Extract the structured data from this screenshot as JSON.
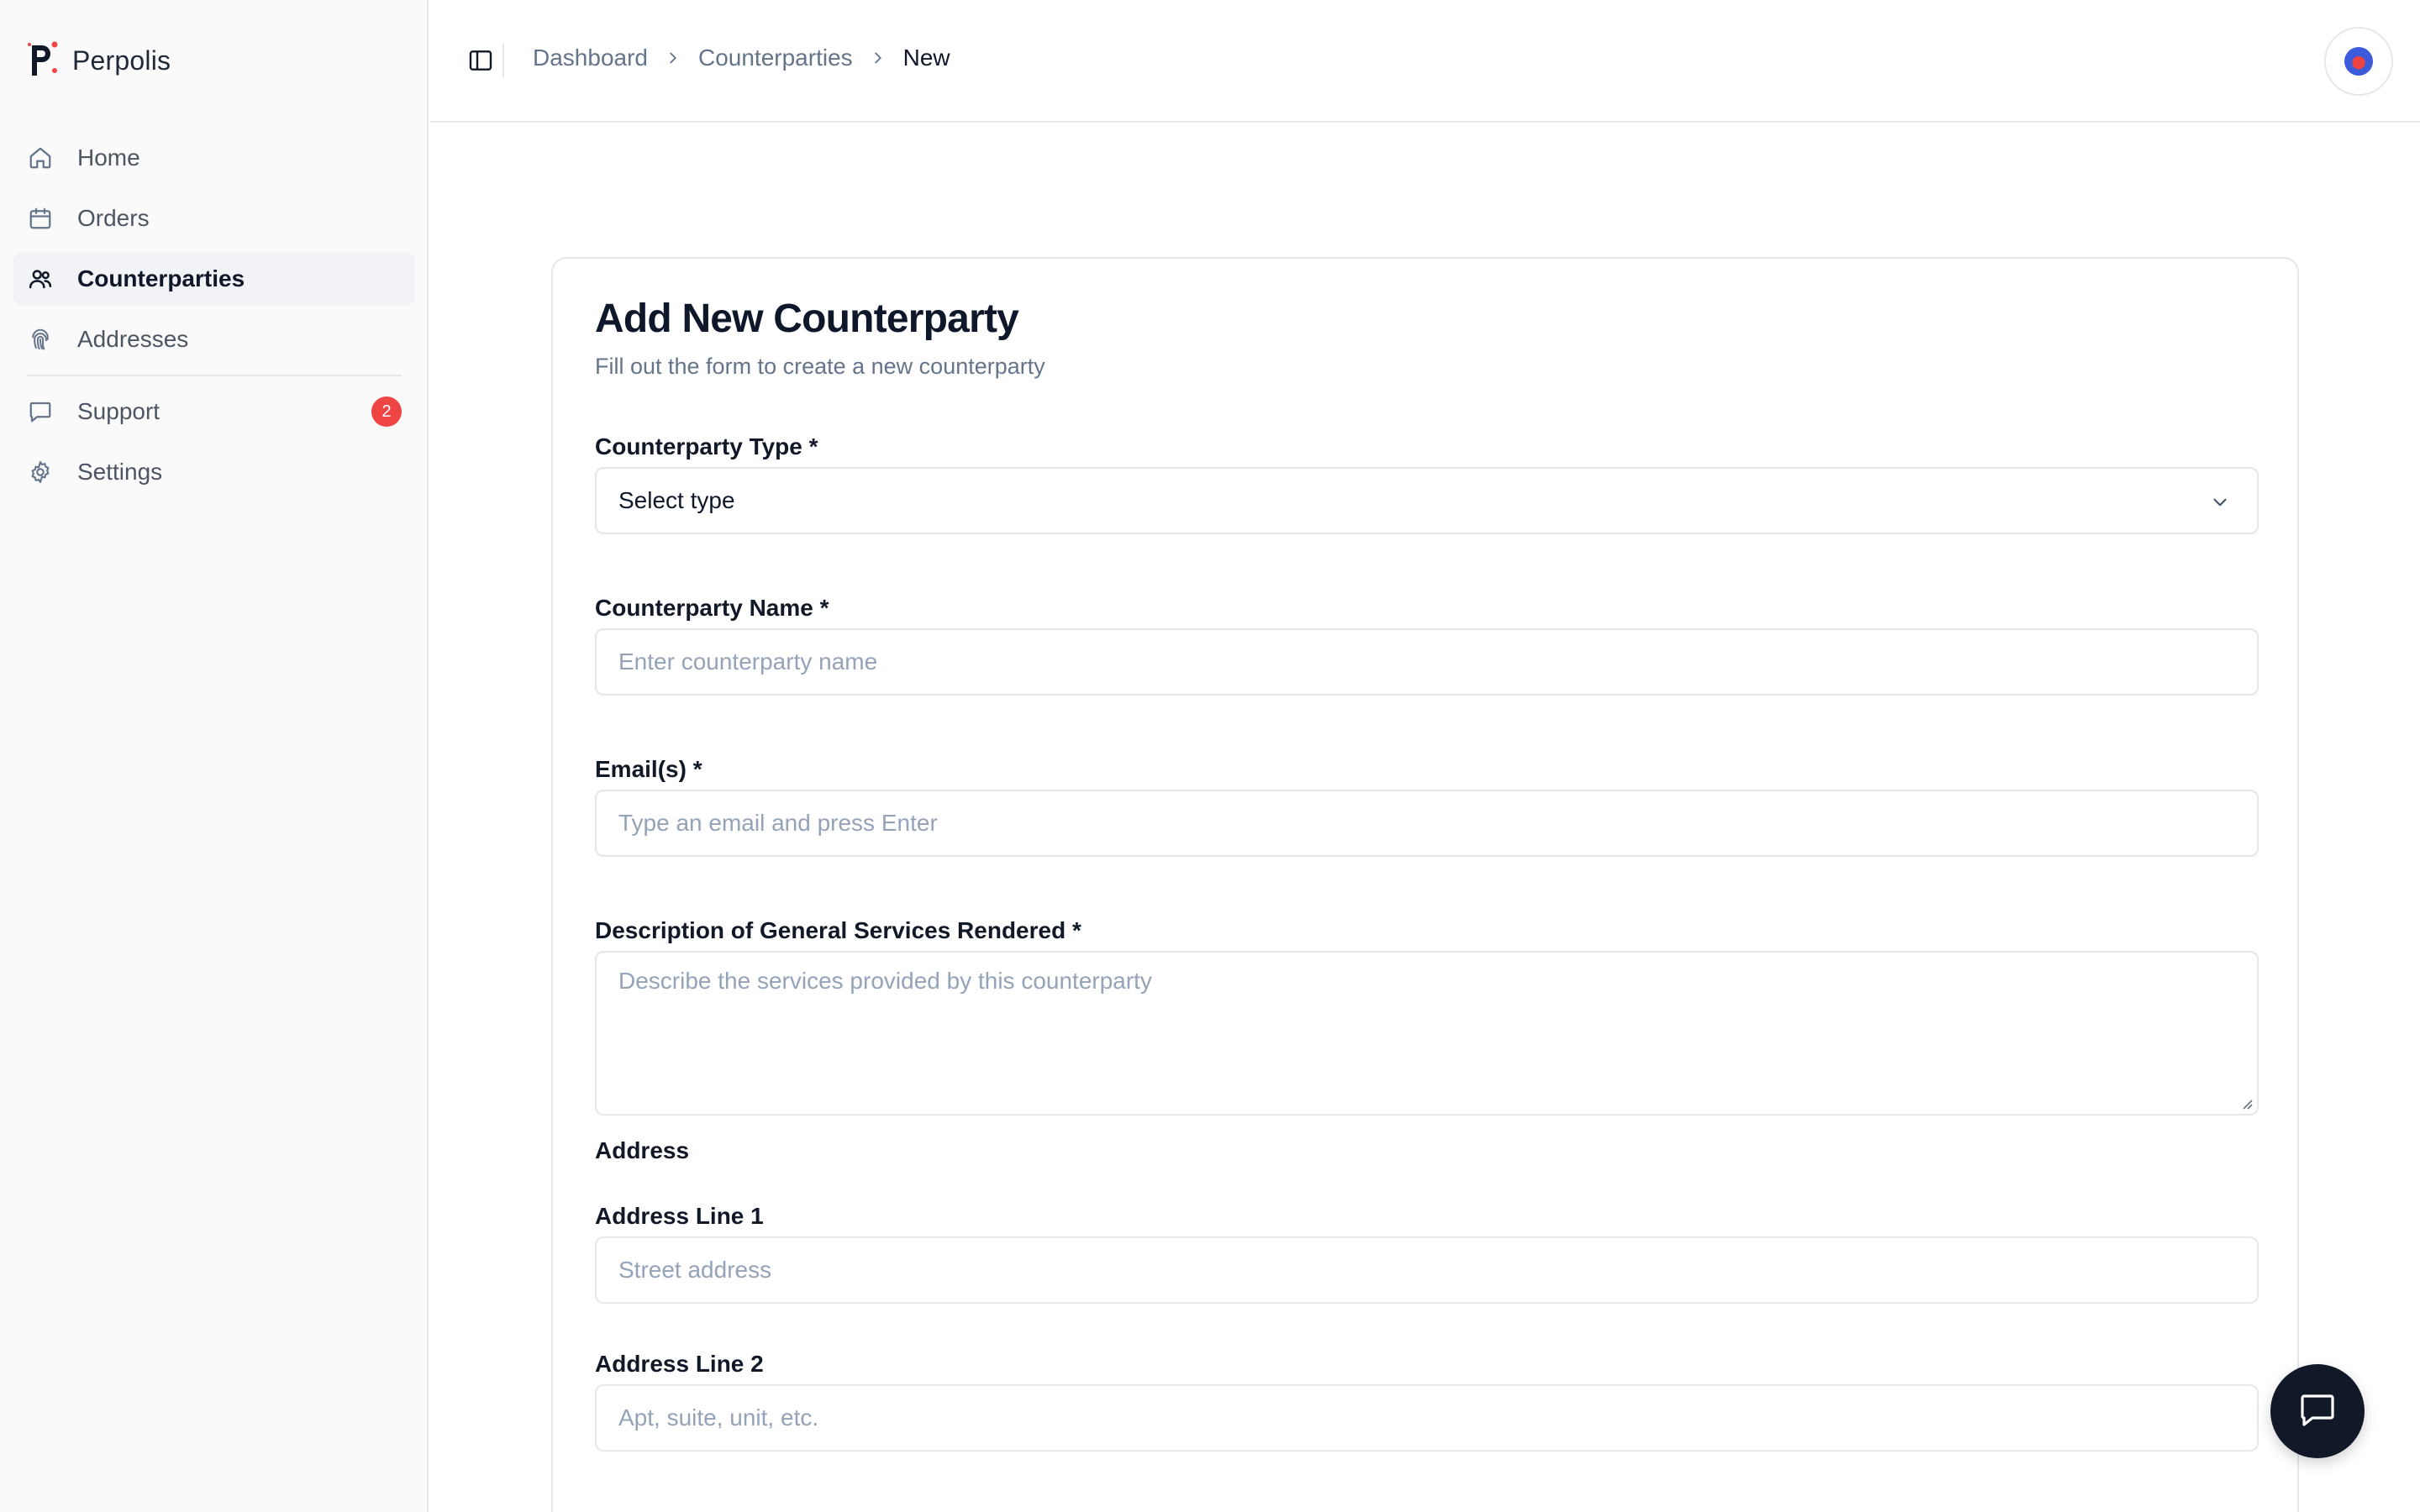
{
  "app": {
    "name": "Perpolis"
  },
  "sidebar": {
    "items": [
      {
        "label": "Home",
        "icon": "home-icon",
        "active": false
      },
      {
        "label": "Orders",
        "icon": "calendar-icon",
        "active": false
      },
      {
        "label": "Counterparties",
        "icon": "users-icon",
        "active": true
      },
      {
        "label": "Addresses",
        "icon": "fingerprint-icon",
        "active": false
      }
    ],
    "secondary": [
      {
        "label": "Support",
        "icon": "message-icon",
        "badge": "2"
      },
      {
        "label": "Settings",
        "icon": "gear-icon"
      }
    ]
  },
  "header": {
    "breadcrumb": [
      "Dashboard",
      "Counterparties",
      "New"
    ]
  },
  "form": {
    "title": "Add New Counterparty",
    "subtitle": "Fill out the form to create a new counterparty",
    "type": {
      "label": "Counterparty Type *",
      "value": "Select type"
    },
    "name": {
      "label": "Counterparty Name *",
      "placeholder": "Enter counterparty name"
    },
    "emails": {
      "label": "Email(s) *",
      "placeholder": "Type an email and press Enter"
    },
    "description": {
      "label": "Description of General Services Rendered *",
      "placeholder": "Describe the services provided by this counterparty"
    },
    "address_section": "Address",
    "address1": {
      "label": "Address Line 1",
      "placeholder": "Street address"
    },
    "address2": {
      "label": "Address Line 2",
      "placeholder": "Apt, suite, unit, etc."
    }
  },
  "colors": {
    "accent": "#0f172a",
    "badge": "#ef4444",
    "muted": "#64748b",
    "border": "#e5e7eb"
  }
}
